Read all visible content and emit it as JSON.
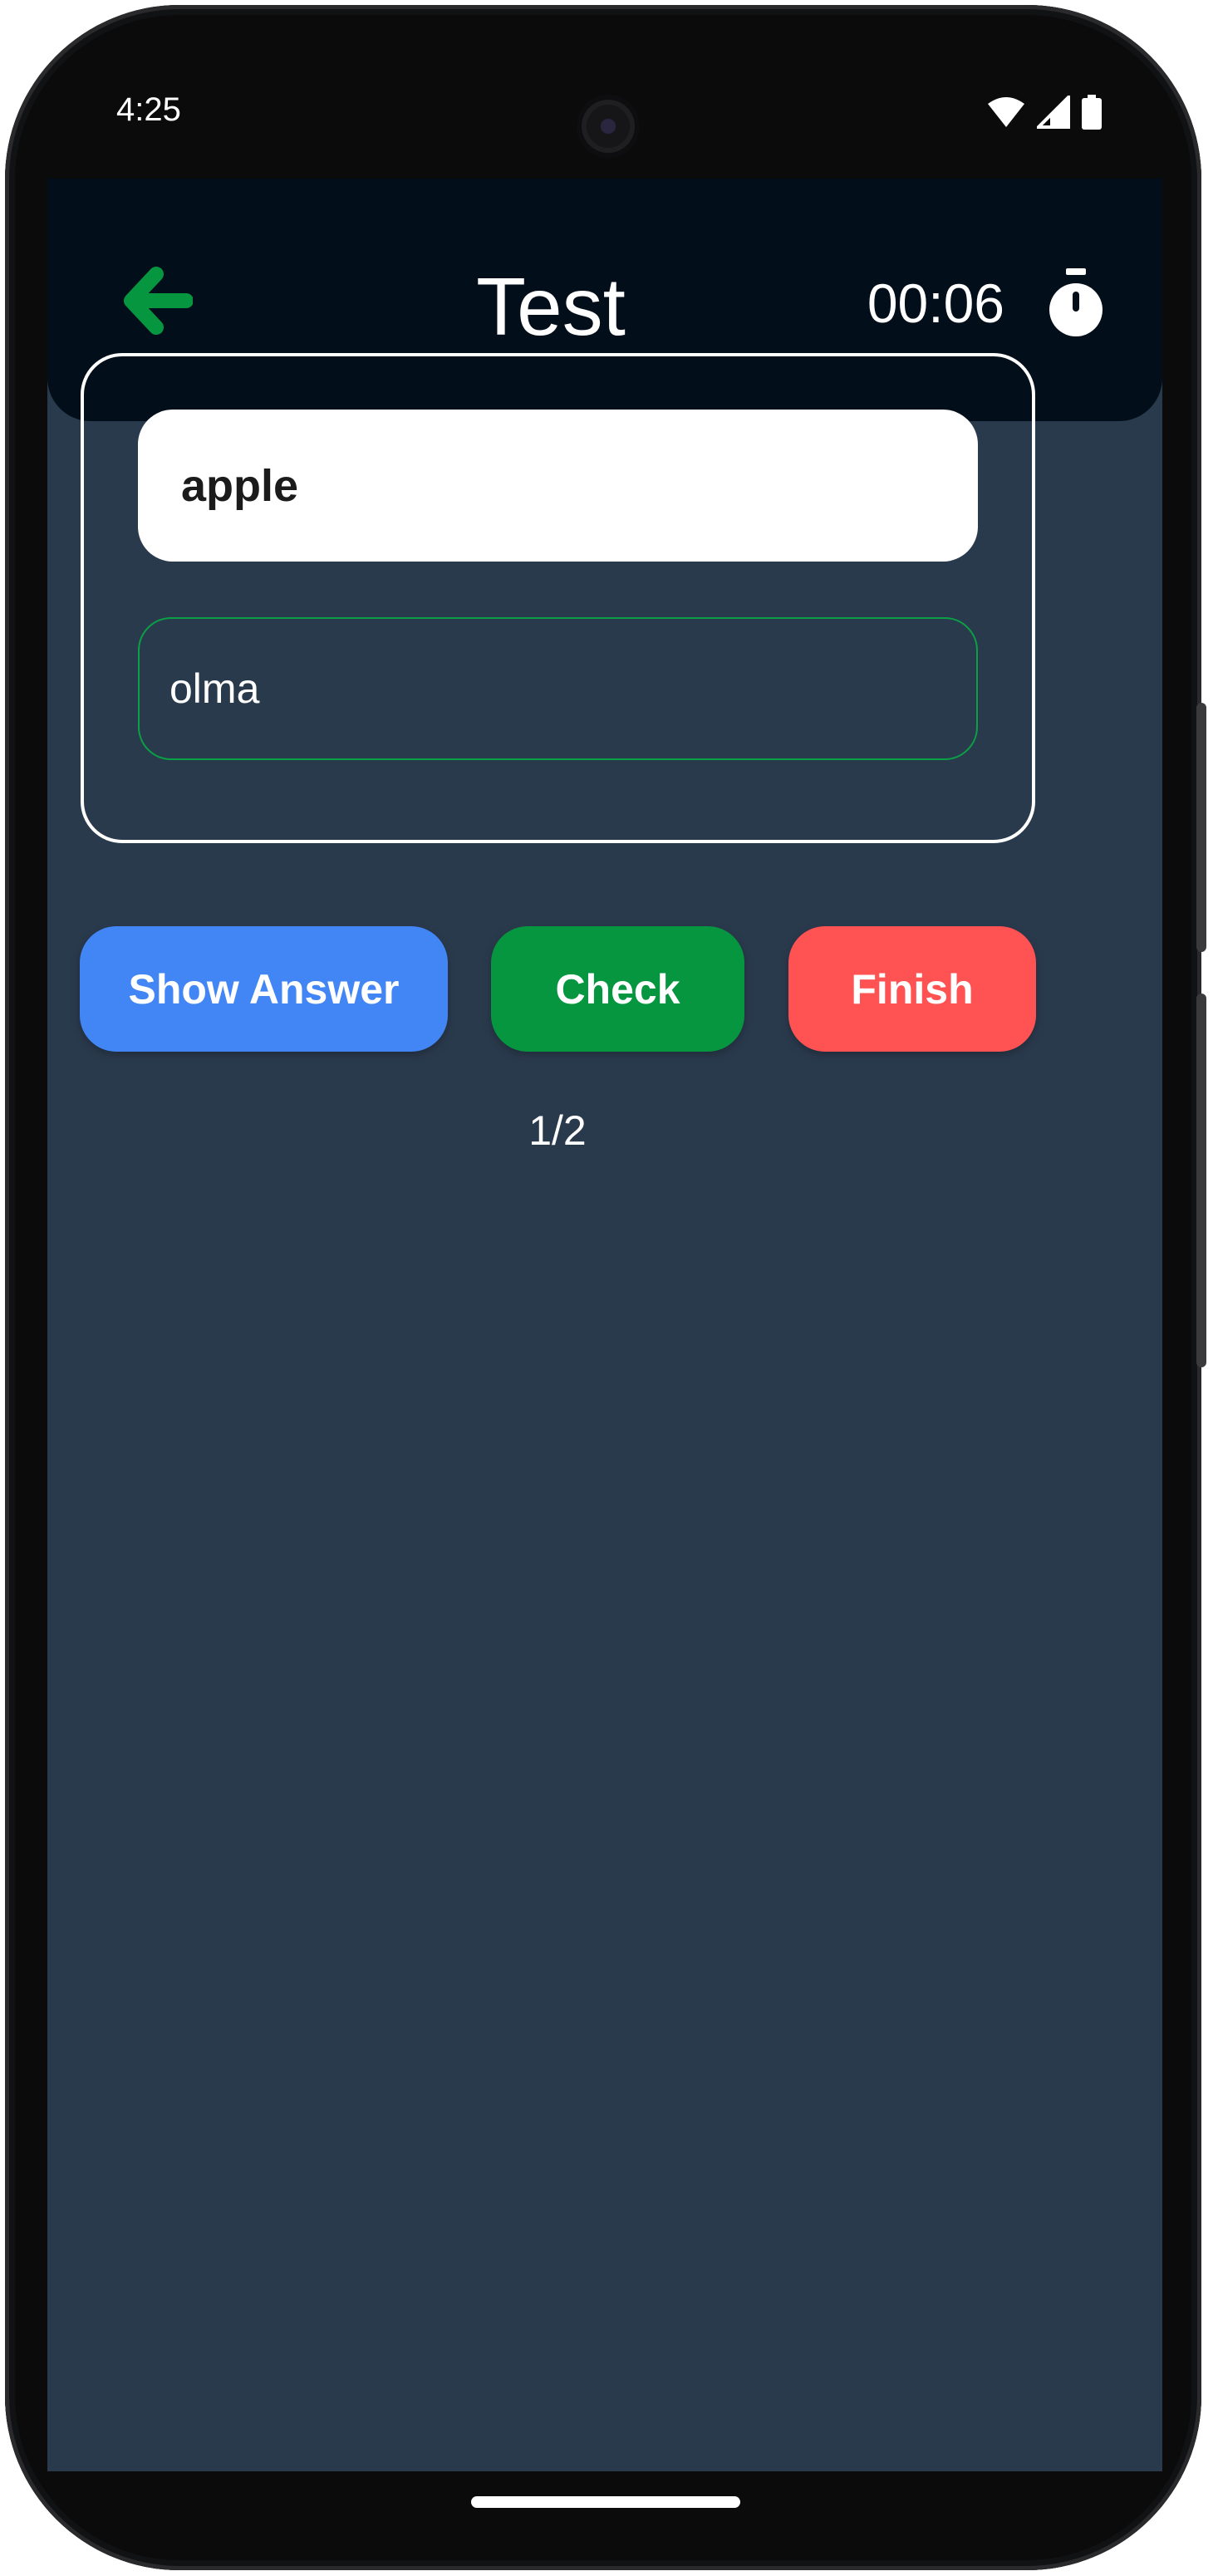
{
  "status_bar": {
    "time": "4:25",
    "icons": [
      "wifi-icon",
      "signal-icon",
      "battery-icon"
    ]
  },
  "app_bar": {
    "back_icon": "arrow-left-icon",
    "title": "Test",
    "timer": "00:06",
    "timer_icon": "stopwatch-icon"
  },
  "card": {
    "word": "apple",
    "answer_value": "olma",
    "answer_placeholder": ""
  },
  "buttons": {
    "show_answer": "Show Answer",
    "check": "Check",
    "finish": "Finish"
  },
  "progress": "1/2",
  "colors": {
    "background": "#2a3a4d",
    "app_bar": "#020e1a",
    "accent_green": "#079640",
    "show_answer_blue": "#4285f4",
    "finish_red": "#ff5252"
  }
}
